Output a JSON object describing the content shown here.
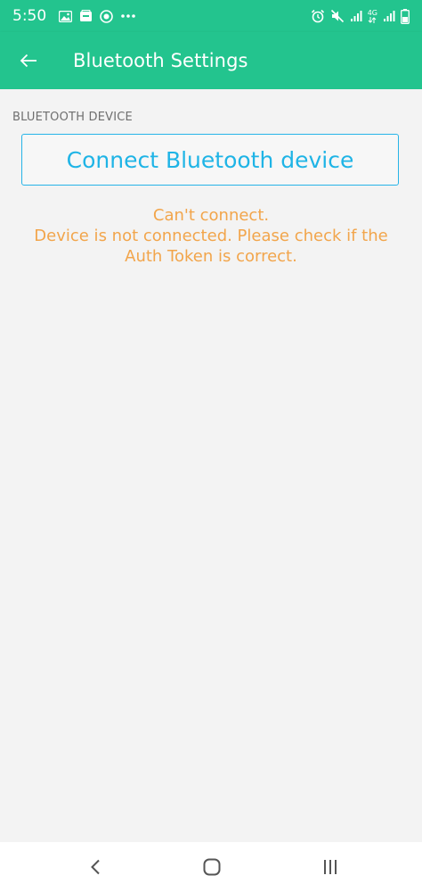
{
  "status_bar": {
    "time": "5:50",
    "network_label": "4G",
    "left_icons": [
      "image-icon",
      "wallet-icon",
      "blynk-icon",
      "more-dots-icon"
    ],
    "right_icons": [
      "alarm-icon",
      "mute-icon",
      "signal-icon",
      "network-4g-icon",
      "signal-icon",
      "battery-icon"
    ]
  },
  "app_bar": {
    "title": "Bluetooth Settings",
    "back_icon": "arrow-back-icon"
  },
  "main": {
    "section_label": "BLUETOOTH DEVICE",
    "connect_button_label": "Connect Bluetooth device",
    "error_line1": "Can't connect.",
    "error_line2": "Device is not connected. Please check if the Auth Token is correct."
  },
  "nav_bar": {
    "back_icon": "nav-back-icon",
    "home_icon": "nav-home-icon",
    "recents_icon": "nav-recents-icon"
  },
  "colors": {
    "primary": "#23c48e",
    "accent_blue": "#1fb4e6",
    "error_orange": "#f2a54b",
    "background": "#f3f3f3"
  }
}
